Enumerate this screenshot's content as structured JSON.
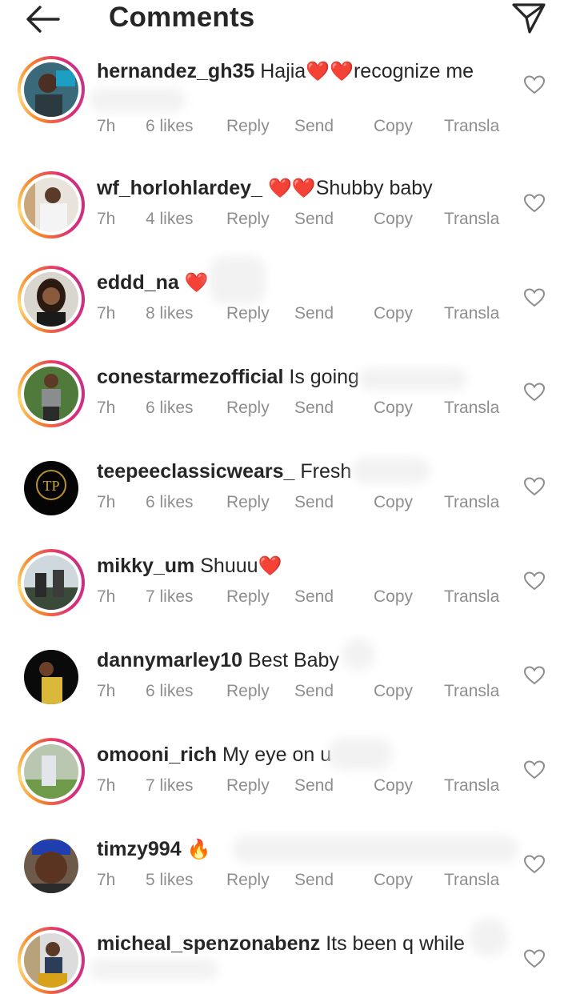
{
  "header": {
    "title": "Comments",
    "back_icon": "arrow-left-icon",
    "send_icon": "paper-plane-icon"
  },
  "colors": {
    "text": "#262626",
    "meta": "#8e8e8e",
    "heart_red": "#e0245e",
    "story_ring": [
      "#f58529",
      "#dd2a7b",
      "#c13584"
    ]
  },
  "actions": {
    "reply": "Reply",
    "send": "Send",
    "copy": "Copy",
    "translate": "Transla"
  },
  "comments": [
    {
      "username": "hernandez_gh35",
      "pre": "Hajia",
      "emoji": "❤️❤️",
      "post": "recognize me",
      "time": "7h",
      "likes": "6 likes"
    },
    {
      "username": "wf_horlohlardey_",
      "pre": "",
      "emoji": "❤️❤️",
      "post": "Shubby baby",
      "time": "7h",
      "likes": "4 likes"
    },
    {
      "username": "eddd_na",
      "pre": "",
      "emoji": "❤️",
      "post": "",
      "time": "7h",
      "likes": "8 likes"
    },
    {
      "username": "conestarmezofficial",
      "pre": "Is going",
      "emoji": "",
      "post": "",
      "time": "7h",
      "likes": "6 likes"
    },
    {
      "username": "teepeeclassicwears_",
      "pre": "Fresh",
      "emoji": "",
      "post": "",
      "time": "7h",
      "likes": "6 likes"
    },
    {
      "username": "mikky_um",
      "pre": "Shuuu",
      "emoji": "❤️",
      "post": "",
      "time": "7h",
      "likes": "7 likes"
    },
    {
      "username": "dannymarley10",
      "pre": "Best Baby",
      "emoji": "",
      "post": "",
      "time": "7h",
      "likes": "6 likes"
    },
    {
      "username": "omooni_rich",
      "pre": "My eye on u",
      "emoji": "",
      "post": "",
      "time": "7h",
      "likes": "7 likes"
    },
    {
      "username": "timzy994",
      "pre": "",
      "emoji": "🔥",
      "post": "",
      "time": "7h",
      "likes": "5 likes"
    },
    {
      "username": "micheal_spenzonabenz",
      "pre": "Its been q while",
      "emoji": "",
      "post": "",
      "time": "",
      "likes": ""
    }
  ]
}
